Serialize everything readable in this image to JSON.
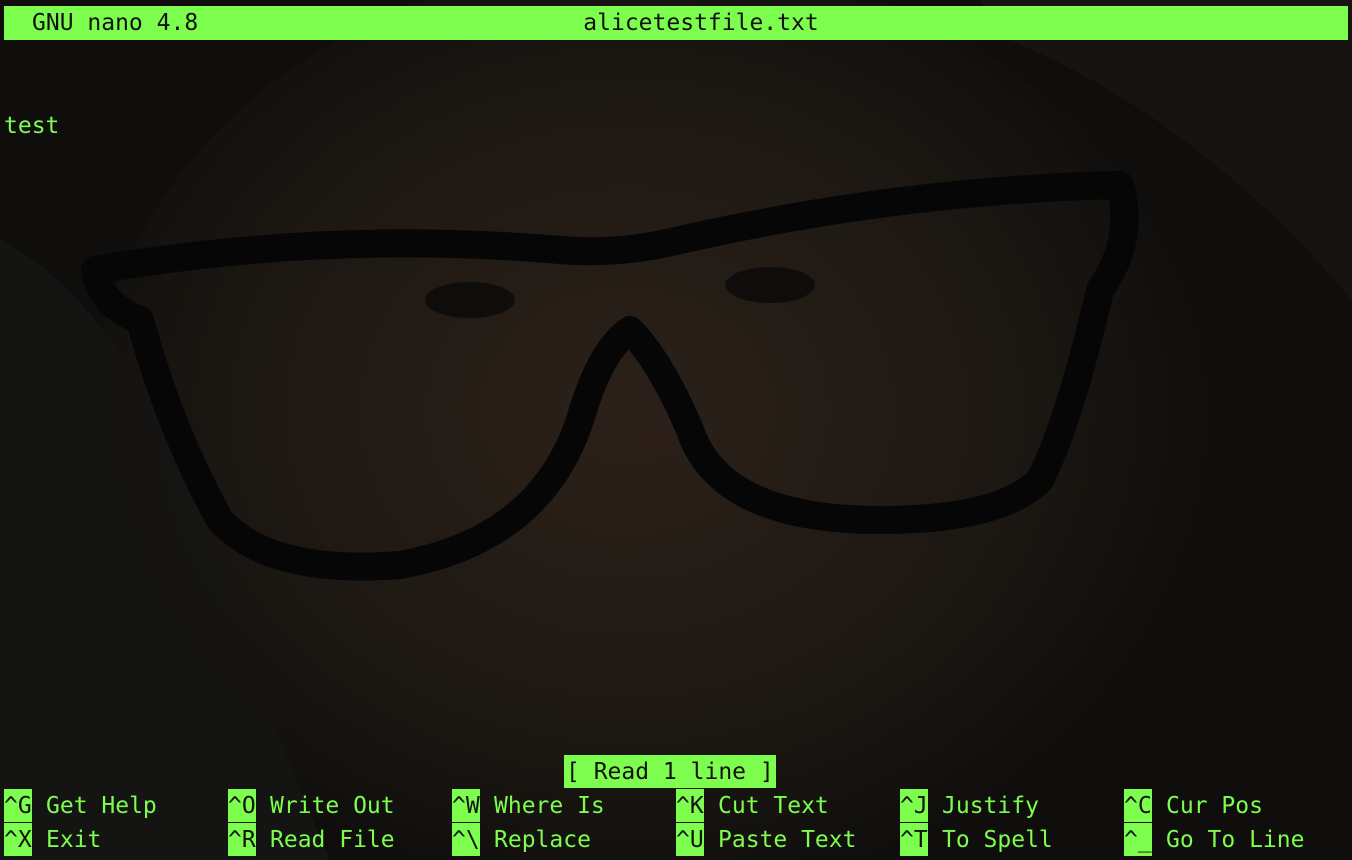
{
  "header": {
    "version": "GNU nano 4.8",
    "filename": "alicetestfile.txt"
  },
  "buffer": {
    "lines": [
      "test"
    ]
  },
  "status": "[ Read 1 line ]",
  "shortcuts": [
    {
      "key": "^G",
      "label": "Get Help"
    },
    {
      "key": "^O",
      "label": "Write Out"
    },
    {
      "key": "^W",
      "label": "Where Is"
    },
    {
      "key": "^K",
      "label": "Cut Text"
    },
    {
      "key": "^J",
      "label": "Justify"
    },
    {
      "key": "^C",
      "label": "Cur Pos"
    },
    {
      "key": "^X",
      "label": "Exit"
    },
    {
      "key": "^R",
      "label": "Read File"
    },
    {
      "key": "^\\",
      "label": "Replace"
    },
    {
      "key": "^U",
      "label": "Paste Text"
    },
    {
      "key": "^T",
      "label": "To Spell"
    },
    {
      "key": "^_",
      "label": "Go To Line"
    }
  ],
  "theme": {
    "accent": "#7dfd4e",
    "background": "#0c0b0a"
  }
}
